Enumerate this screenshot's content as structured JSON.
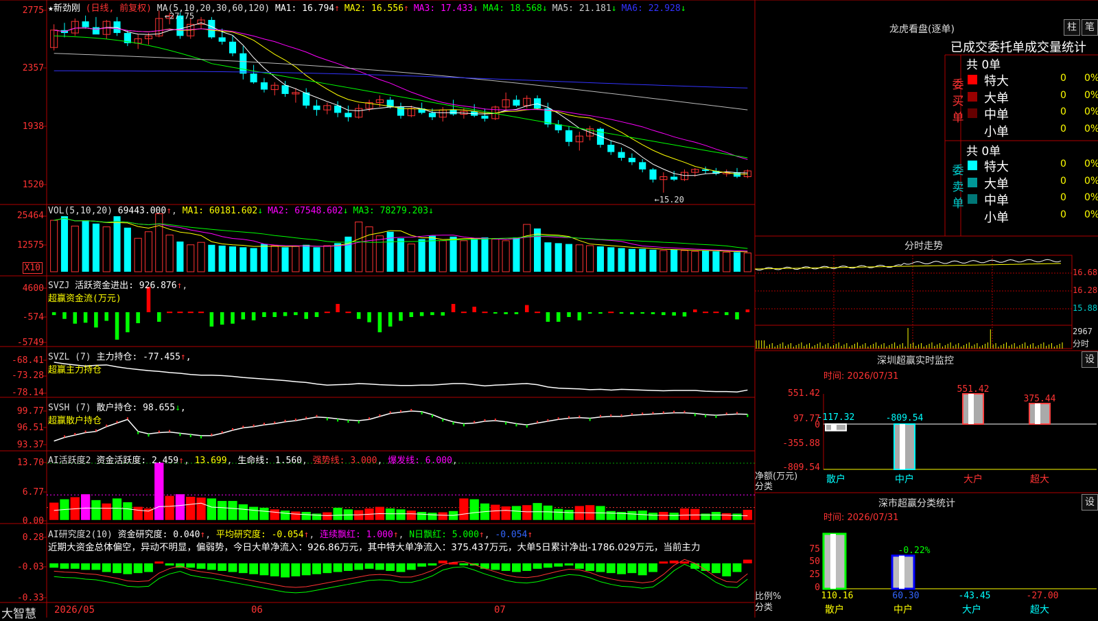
{
  "stock": {
    "name": "★新劲刚",
    "mode": "(日线, 前复权)",
    "high_label": "27.75",
    "low_label": "15.20",
    "ma_header": "MA(5,10,20,30,60,120)",
    "ma": [
      {
        "label": "MA1:",
        "value": "16.794",
        "arrow": "↑",
        "color": "#ffffff"
      },
      {
        "label": "MA2:",
        "value": "16.556",
        "arrow": "↑",
        "color": "#ffff00"
      },
      {
        "label": "MA3:",
        "value": "17.433",
        "arrow": "↓",
        "color": "#ff00ff"
      },
      {
        "label": "MA4:",
        "value": "18.568",
        "arrow": "↓",
        "color": "#00ff00"
      },
      {
        "label": "MA5:",
        "value": "21.181",
        "arrow": "↓",
        "color": "#cccccc"
      },
      {
        "label": "MA6:",
        "value": "22.928",
        "arrow": "↓",
        "color": "#3333ff"
      }
    ]
  },
  "yaxis": {
    "price": [
      "2775",
      "2357",
      "1938",
      "1520"
    ],
    "vol": [
      "25464",
      "12575"
    ],
    "vol_unit": "X10",
    "svzj": [
      "4600",
      "-574",
      "-5749"
    ],
    "svzl": [
      "-68.41",
      "-73.28",
      "-78.14"
    ],
    "svsh": [
      "99.77",
      "96.51",
      "93.37"
    ],
    "ai1": [
      "13.70",
      "6.77",
      "0.00"
    ],
    "ai2": [
      "0.28",
      "-0.03",
      "-0.33"
    ]
  },
  "vol_hdr": {
    "name": "VOL(5,10,20)",
    "value": "69443.000",
    "arrow": "↑",
    "ma": [
      {
        "label": "MA1:",
        "value": "60181.602",
        "arrow": "↓",
        "color": "#ffff00"
      },
      {
        "label": "MA2:",
        "value": "67548.602",
        "arrow": "↓",
        "color": "#ff00ff"
      },
      {
        "label": "MA3:",
        "value": "78279.203",
        "arrow": "↓",
        "color": "#00ff00"
      }
    ]
  },
  "svzj_hdr": {
    "name": "SVZJ",
    "label": "活跃资金进出:",
    "value": "926.876",
    "arrow": "↑",
    "sub": "超赢资金流(万元)"
  },
  "svzl_hdr": {
    "name": "SVZL (7)",
    "label": "主力持仓:",
    "value": "-77.455",
    "arrow": "↑",
    "tail": ",",
    "sub": "超赢主力持仓"
  },
  "svsh_hdr": {
    "name": "SVSH (7)",
    "label": "散户持仓:",
    "value": "98.655",
    "arrow": "↓",
    "tail": ",",
    "sub": "超赢散户持仓"
  },
  "ai1_hdr": {
    "name": "AI活跃度2",
    "label": "资金活跃度:",
    "value": "2.459",
    "arrow": "↑",
    "v2": "13.699",
    "l3": "生命线:",
    "v3": "1.560",
    "l4": "强势线:",
    "v4": "3.000",
    "l5": "爆发线:",
    "v5": "6.000"
  },
  "ai2_hdr": {
    "name": "AI研究度2(10)",
    "label": "资金研究度:",
    "value": "0.040",
    "arrow": "↑",
    "l2": "平均研究度:",
    "v2": "-0.054",
    "a2": "↑",
    "l3": "连续飘红:",
    "v3": "1.000",
    "a3": "↑",
    "l4": "N日飘红:",
    "v4": "5.000",
    "a4": "↑",
    "v5": "-0.054",
    "a5": "↑",
    "comment": "近期大资金总体偏空，异动不明显，偏弱势，今日大单净流入：926.86万元，其中特大单净流入：375.437万元，大单5日累计净出-1786.029万元，当前主力"
  },
  "xaxis": {
    "logo": "大智慧",
    "labels": [
      "2026/05",
      "06",
      "07"
    ]
  },
  "lhb": {
    "title": "龙虎看盘(逐单)",
    "btn_bar": "柱",
    "btn_pen": "笔",
    "tabs": "已成交委托单成交量统计",
    "buy": {
      "side": "委买单",
      "count": "共 0单",
      "rows": [
        {
          "name": "特大",
          "num": "0",
          "pct": "0%",
          "color": "#ff0000"
        },
        {
          "name": "大单",
          "num": "0",
          "pct": "0%",
          "color": "#990000"
        },
        {
          "name": "中单",
          "num": "0",
          "pct": "0%",
          "color": "#660000"
        },
        {
          "name": "小单",
          "num": "0",
          "pct": "0%",
          "color": "#000000"
        }
      ]
    },
    "sell": {
      "side": "委卖单",
      "count": "共 0单",
      "rows": [
        {
          "name": "特大",
          "num": "0",
          "pct": "0%",
          "color": "#00ffff"
        },
        {
          "name": "大单",
          "num": "0",
          "pct": "0%",
          "color": "#009999"
        },
        {
          "name": "中单",
          "num": "0",
          "pct": "0%",
          "color": "#007777"
        },
        {
          "name": "小单",
          "num": "0",
          "pct": "0%",
          "color": "#000000"
        }
      ]
    }
  },
  "intraday": {
    "title": "分时走势",
    "labels": [
      "16.68",
      "16.28",
      "15.88"
    ],
    "vol_label": "2967",
    "vol_unit": "分时"
  },
  "monitor": {
    "title": "深圳超赢实时监控",
    "btn": "设",
    "time": "时间: 2026/07/31",
    "ylabels": [
      "551.42",
      "97.77",
      "0",
      "-355.88",
      "-809.54"
    ],
    "unit": "净额(万元)",
    "unit2": "分类"
  },
  "classify": {
    "title": "深市超赢分类统计",
    "btn": "设",
    "time": "时间: 2026/07/31",
    "ylabels": [
      "75",
      "50",
      "25",
      "0"
    ],
    "unit": "比例%",
    "unit2": "分类",
    "top_label": "-0.22%"
  },
  "chart_data": [
    {
      "type": "candlestick",
      "title": "新劲刚",
      "categories_note": "daily 2026/05 - 2026/07",
      "ohlc": [
        [
          25.2,
          26.8,
          25.0,
          26.4
        ],
        [
          26.4,
          26.9,
          25.9,
          26.2
        ],
        [
          26.2,
          27.2,
          26.0,
          27.0
        ],
        [
          27.0,
          27.4,
          26.5,
          26.6
        ],
        [
          26.6,
          27.3,
          26.2,
          26.1
        ],
        [
          26.1,
          27.1,
          25.8,
          27.0
        ],
        [
          27.0,
          27.3,
          26.0,
          26.2
        ],
        [
          26.2,
          26.4,
          25.3,
          25.5
        ],
        [
          25.5,
          26.1,
          25.1,
          25.8
        ],
        [
          25.8,
          26.2,
          25.4,
          26.0
        ],
        [
          26.0,
          27.75,
          25.9,
          27.2
        ],
        [
          27.2,
          27.6,
          26.8,
          27.4
        ],
        [
          27.4,
          27.6,
          25.8,
          26.0
        ],
        [
          26.0,
          27.2,
          25.8,
          26.8
        ],
        [
          26.8,
          27.3,
          26.5,
          27.1
        ],
        [
          27.1,
          27.3,
          25.8,
          25.9
        ],
        [
          25.9,
          26.5,
          25.4,
          25.6
        ],
        [
          25.6,
          26.0,
          24.6,
          24.8
        ],
        [
          24.8,
          25.3,
          23.0,
          23.4
        ],
        [
          23.4,
          24.0,
          22.7,
          22.8
        ],
        [
          22.8,
          23.1,
          22.1,
          22.3
        ],
        [
          22.3,
          22.8,
          21.9,
          22.6
        ],
        [
          22.6,
          22.9,
          21.8,
          22.0
        ],
        [
          22.0,
          22.4,
          21.4,
          22.1
        ],
        [
          22.1,
          22.4,
          21.0,
          21.2
        ],
        [
          21.2,
          21.6,
          20.5,
          20.9
        ],
        [
          20.9,
          21.4,
          20.6,
          21.2
        ],
        [
          21.2,
          21.5,
          20.4,
          20.7
        ],
        [
          20.7,
          21.2,
          20.1,
          20.4
        ],
        [
          20.4,
          21.3,
          20.3,
          21.0
        ],
        [
          21.0,
          21.6,
          20.8,
          21.4
        ],
        [
          21.4,
          21.9,
          21.1,
          21.6
        ],
        [
          21.6,
          21.8,
          21.0,
          21.1
        ],
        [
          21.1,
          21.4,
          20.3,
          20.5
        ],
        [
          20.5,
          21.2,
          20.4,
          21.0
        ],
        [
          21.0,
          21.4,
          20.6,
          20.7
        ],
        [
          20.7,
          21.0,
          20.2,
          20.4
        ],
        [
          20.4,
          21.1,
          20.1,
          20.9
        ],
        [
          20.9,
          21.6,
          20.5,
          20.6
        ],
        [
          20.6,
          21.0,
          20.3,
          20.8
        ],
        [
          20.8,
          21.3,
          20.4,
          20.5
        ],
        [
          20.5,
          21.0,
          20.1,
          20.3
        ],
        [
          20.3,
          21.2,
          20.2,
          21.1
        ],
        [
          21.1,
          22.1,
          20.9,
          21.6
        ],
        [
          21.6,
          21.9,
          21.1,
          21.2
        ],
        [
          21.2,
          21.9,
          21.0,
          21.7
        ],
        [
          21.7,
          21.9,
          20.9,
          21.0
        ],
        [
          21.0,
          21.4,
          19.7,
          19.9
        ],
        [
          19.9,
          20.2,
          19.3,
          19.5
        ],
        [
          19.5,
          19.8,
          18.4,
          18.7
        ],
        [
          18.7,
          19.4,
          18.1,
          19.1
        ],
        [
          19.1,
          19.8,
          18.8,
          19.6
        ],
        [
          19.6,
          19.7,
          18.3,
          18.5
        ],
        [
          18.5,
          18.8,
          17.8,
          18.0
        ],
        [
          18.0,
          18.3,
          17.4,
          17.6
        ],
        [
          17.6,
          17.9,
          17.1,
          17.3
        ],
        [
          17.3,
          17.5,
          16.6,
          16.8
        ],
        [
          16.8,
          16.9,
          15.9,
          16.1
        ],
        [
          16.1,
          16.6,
          15.2,
          16.3
        ],
        [
          16.3,
          16.7,
          16.0,
          16.1
        ],
        [
          16.1,
          16.8,
          16.0,
          16.6
        ],
        [
          16.6,
          16.9,
          16.3,
          16.8
        ],
        [
          16.8,
          17.0,
          16.5,
          16.7
        ],
        [
          16.7,
          16.9,
          16.4,
          16.5
        ],
        [
          16.5,
          16.8,
          16.3,
          16.6
        ],
        [
          16.6,
          16.9,
          16.2,
          16.3
        ],
        [
          16.3,
          16.8,
          16.2,
          16.7
        ]
      ]
    },
    {
      "type": "bar",
      "title": "VOL",
      "values": [
        6.3,
        6.8,
        5.6,
        6.3,
        5.9,
        5.5,
        6.8,
        5.4,
        4.1,
        4.9,
        7.1,
        4.5,
        3.7,
        3.3,
        3.6,
        3.3,
        3.2,
        3.1,
        3.0,
        2.9,
        3.4,
        3.2,
        3.0,
        3.1,
        3.3,
        3.0,
        3.2,
        3.5,
        4.3,
        6.1,
        5.5,
        4.4,
        4.9,
        4.1,
        3.4,
        4.0,
        4.4,
        3.8,
        4.3,
        3.8,
        4.1,
        4.2,
        4.0,
        3.8,
        4.2,
        5.8,
        5.3,
        3.6,
        3.5,
        3.4,
        3.3,
        3.2,
        3.1,
        3.0,
        2.9,
        2.8,
        2.8,
        2.7,
        2.6,
        2.7,
        2.6,
        2.5,
        2.6,
        2.5,
        2.4,
        2.4,
        2.3
      ]
    },
    {
      "type": "bar",
      "title": "超赢资金流(万元)",
      "values": [
        -600,
        -1400,
        -2400,
        -2200,
        -3200,
        -1800,
        -5749,
        -4200,
        -2300,
        4600,
        -2000,
        100,
        100,
        100,
        100,
        -3000,
        -2600,
        -2400,
        -1500,
        -1700,
        -1000,
        -1000,
        -800,
        -600,
        -1400,
        -1000,
        100,
        1500,
        100,
        -1400,
        -2100,
        -4200,
        -3000,
        -1800,
        -1000,
        -800,
        -600,
        -700,
        1500,
        100,
        1000,
        100,
        -200,
        -400,
        -400,
        1300,
        100,
        -2000,
        -2000,
        -1000,
        -1700,
        -300,
        -300,
        100,
        -300,
        -400,
        -300,
        -400,
        -600,
        -700,
        -900,
        500,
        100,
        100,
        -600,
        -1500,
        500
      ]
    },
    {
      "type": "line",
      "title": "超赢主力持仓",
      "y": [
        -70.2,
        -70.6,
        -70.9,
        -71.2,
        -71.0,
        -70.9,
        -71.4,
        -71.8,
        -72.1,
        -72.4,
        -72.6,
        -72.9,
        -73.1,
        -73.4,
        -73.6,
        -73.6,
        -73.7,
        -73.9,
        -74.2,
        -74.4,
        -74.6,
        -74.8,
        -75.0,
        -75.3,
        -75.5,
        -75.9,
        -76.2,
        -76.1,
        -76.0,
        -75.8,
        -75.9,
        -76.1,
        -76.2,
        -76.3,
        -76.3,
        -76.2,
        -76.2,
        -76.0,
        -75.8,
        -75.8,
        -76.1,
        -76.4,
        -76.2,
        -76.1,
        -75.9,
        -75.8,
        -76.1,
        -76.7,
        -77.0,
        -77.1,
        -77.2,
        -77.4,
        -77.3,
        -77.5,
        -77.3,
        -77.4,
        -77.5,
        -77.6,
        -77.7,
        -77.6,
        -77.6,
        -77.6,
        -77.8,
        -77.9,
        -77.9,
        -78.0,
        -77.5
      ]
    },
    {
      "type": "line",
      "title": "超赢散户持仓",
      "y": [
        94.2,
        94.8,
        95.2,
        95.6,
        95.8,
        96.6,
        97.2,
        97.8,
        95.8,
        95.4,
        95.6,
        95.7,
        95.5,
        95.3,
        95.1,
        95.1,
        95.5,
        96.0,
        96.4,
        96.6,
        96.9,
        97.1,
        97.4,
        97.6,
        97.9,
        98.2,
        98.1,
        97.9,
        97.7,
        97.6,
        97.8,
        98.3,
        98.8,
        99.0,
        99.2,
        99.1,
        98.6,
        97.9,
        97.4,
        97.1,
        97.2,
        97.5,
        97.6,
        97.4,
        97.1,
        96.9,
        97.2,
        97.5,
        97.8,
        98.0,
        98.1,
        98.0,
        98.2,
        98.3,
        98.3,
        98.5,
        98.6,
        98.7,
        98.8,
        98.9,
        98.9,
        98.8,
        98.6,
        98.5,
        98.6,
        98.7,
        98.655
      ]
    },
    {
      "type": "bar",
      "title": "AI活跃度2",
      "values": [
        4.2,
        5.0,
        5.5,
        6.2,
        4.8,
        4.0,
        5.2,
        4.3,
        3.2,
        2.8,
        13.7,
        5.8,
        6.2,
        5.6,
        5.4,
        5.2,
        4.6,
        4.6,
        3.8,
        3.2,
        3.0,
        2.6,
        2.3,
        2.1,
        2.0,
        1.6,
        1.9,
        3.0,
        2.6,
        2.4,
        2.8,
        3.2,
        2.8,
        2.6,
        2.3,
        2.0,
        1.8,
        1.9,
        2.2,
        5.2,
        5.0,
        4.0,
        3.7,
        3.3,
        3.4,
        3.6,
        4.1,
        3.5,
        2.7,
        2.5,
        3.4,
        3.6,
        3.4,
        2.2,
        2.0,
        2.2,
        2.3,
        1.8,
        2.0,
        1.8,
        2.8,
        2.7,
        1.6,
        2.0,
        1.7,
        1.6,
        2.5
      ]
    },
    {
      "type": "bar",
      "title": "AI研究度2(10)",
      "values": [
        -0.04,
        -0.05,
        -0.05,
        -0.06,
        -0.06,
        -0.08,
        -0.09,
        -0.1,
        -0.09,
        -0.08,
        0.02,
        -0.02,
        -0.04,
        -0.04,
        -0.05,
        -0.06,
        -0.07,
        -0.08,
        -0.09,
        -0.1,
        -0.11,
        -0.12,
        -0.13,
        -0.12,
        -0.11,
        -0.1,
        -0.09,
        -0.08,
        -0.07,
        -0.06,
        -0.05,
        -0.06,
        -0.07,
        -0.08,
        -0.06,
        -0.03,
        -0.02,
        0.03,
        0.01,
        -0.01,
        -0.02,
        -0.05,
        -0.06,
        -0.07,
        -0.08,
        -0.07,
        -0.05,
        -0.04,
        -0.03,
        -0.02,
        -0.05,
        -0.07,
        -0.08,
        -0.09,
        -0.1,
        -0.09,
        -0.11,
        -0.08,
        0.02,
        0.03,
        0.02,
        -0.05,
        -0.07,
        -0.09,
        -0.12,
        -0.08,
        0.04
      ]
    },
    {
      "type": "bar",
      "title": "深圳超赢实时监控",
      "categories": [
        "散户",
        "中户",
        "大户",
        "超大"
      ],
      "values": [
        -117.32,
        -809.54,
        551.42,
        375.44
      ],
      "ylim": [
        -809.54,
        551.42
      ]
    },
    {
      "type": "bar",
      "title": "深市超赢分类统计",
      "categories": [
        "散户",
        "中户",
        "大户",
        "超大"
      ],
      "values": [
        110.16,
        60.3,
        -43.45,
        -27.0
      ],
      "ylim": [
        0,
        100
      ]
    }
  ]
}
